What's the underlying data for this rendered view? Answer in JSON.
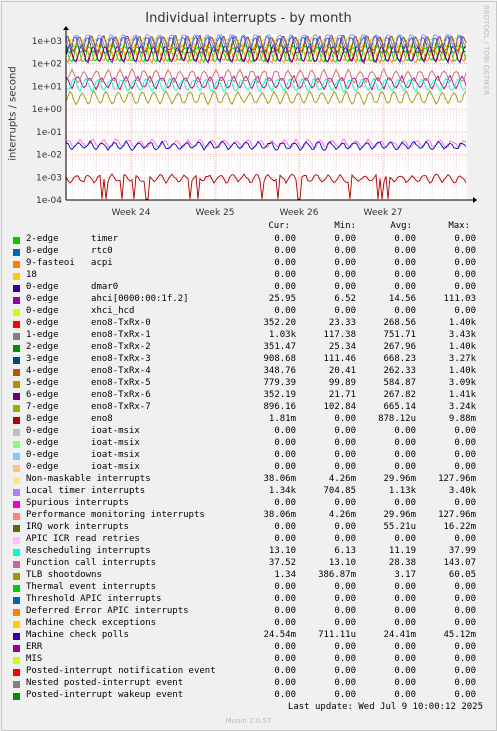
{
  "chart_data": {
    "type": "line",
    "title": "Individual interrupts - by month",
    "ylabel": "interrupts / second",
    "yscale": "log",
    "ylim": [
      0.0001,
      2000
    ],
    "yticks": [
      "1e+03",
      "1e+02",
      "1e+01",
      "1e+00",
      "1e-01",
      "1e-02",
      "1e-03",
      "1e-04"
    ],
    "xticks": [
      "Week 24",
      "Week 25",
      "Week 26",
      "Week 27"
    ],
    "series": [
      {
        "name": "eno8-TxRx-0",
        "color": "#ff0000",
        "level": 268.56
      },
      {
        "name": "eno8-TxRx-1",
        "color": "#a000a0",
        "level": 751.71
      },
      {
        "name": "eno8-TxRx-2",
        "color": "#00cc00",
        "level": 267.96
      },
      {
        "name": "eno8-TxRx-3",
        "color": "#0066b3",
        "level": 668.23
      },
      {
        "name": "eno8-TxRx-4",
        "color": "#ff8000",
        "level": 262.33
      },
      {
        "name": "eno8-TxRx-5",
        "color": "#ffcc00",
        "level": 584.87
      },
      {
        "name": "eno8-TxRx-6",
        "color": "#330099",
        "level": 267.82
      },
      {
        "name": "eno8-TxRx-7",
        "color": "#808000",
        "level": 665.14
      },
      {
        "name": "ahci[0000:00:1f.2]",
        "color": "#990099",
        "level": 14.56
      },
      {
        "name": "Local timer interrupts",
        "color": "#8080ff",
        "level": 1130
      },
      {
        "name": "Rescheduling interrupts",
        "color": "#00ffcc",
        "level": 11.19
      },
      {
        "name": "Function call interrupts",
        "color": "#cc6666",
        "level": 28.38
      },
      {
        "name": "TLB shootdowns",
        "color": "#999900",
        "level": 3.17
      },
      {
        "name": "Non-maskable interrupts",
        "color": "#ff66cc",
        "level": 0.02996
      },
      {
        "name": "Machine check polls",
        "color": "#0000cc",
        "level": 0.02441
      },
      {
        "name": "eno8",
        "color": "#aa0000",
        "level": 0.000878
      }
    ]
  },
  "side_label": "RRDTOOL / TOBI OETIKER",
  "legend": {
    "headers": {
      "cur": "Cur:",
      "min": "Min:",
      "avg": "Avg:",
      "max": "Max:"
    },
    "rows": [
      {
        "color": "#00cc00",
        "name": "2-edge      timer",
        "cur": "0.00",
        "min": "0.00",
        "avg": "0.00",
        "max": "0.00"
      },
      {
        "color": "#0066b3",
        "name": "8-edge      rtc0",
        "cur": "0.00",
        "min": "0.00",
        "avg": "0.00",
        "max": "0.00"
      },
      {
        "color": "#ff8000",
        "name": "9-fasteoi   acpi",
        "cur": "0.00",
        "min": "0.00",
        "avg": "0.00",
        "max": "0.00"
      },
      {
        "color": "#ffcc00",
        "name": "18",
        "cur": "0.00",
        "min": "0.00",
        "avg": "0.00",
        "max": "0.00"
      },
      {
        "color": "#330099",
        "name": "0-edge      dmar0",
        "cur": "0.00",
        "min": "0.00",
        "avg": "0.00",
        "max": "0.00"
      },
      {
        "color": "#990099",
        "name": "0-edge      ahci[0000:00:1f.2]",
        "cur": "25.95",
        "min": "6.52",
        "avg": "14.56",
        "max": "111.03"
      },
      {
        "color": "#ccff00",
        "name": "0-edge      xhci_hcd",
        "cur": "0.00",
        "min": "0.00",
        "avg": "0.00",
        "max": "0.00"
      },
      {
        "color": "#ff0000",
        "name": "0-edge      eno8-TxRx-0",
        "cur": "352.20",
        "min": "23.33",
        "avg": "268.56",
        "max": "1.40k"
      },
      {
        "color": "#808080",
        "name": "1-edge      eno8-TxRx-1",
        "cur": "1.03k",
        "min": "117.38",
        "avg": "751.71",
        "max": "3.43k"
      },
      {
        "color": "#008f00",
        "name": "2-edge      eno8-TxRx-2",
        "cur": "351.47",
        "min": "25.34",
        "avg": "267.96",
        "max": "1.40k"
      },
      {
        "color": "#00487d",
        "name": "3-edge      eno8-TxRx-3",
        "cur": "908.68",
        "min": "111.46",
        "avg": "668.23",
        "max": "3.27k"
      },
      {
        "color": "#b35a00",
        "name": "4-edge      eno8-TxRx-4",
        "cur": "348.76",
        "min": "20.41",
        "avg": "262.33",
        "max": "1.40k"
      },
      {
        "color": "#b38f00",
        "name": "5-edge      eno8-TxRx-5",
        "cur": "779.39",
        "min": "99.89",
        "avg": "584.87",
        "max": "3.09k"
      },
      {
        "color": "#6b006b",
        "name": "6-edge      eno8-TxRx-6",
        "cur": "352.19",
        "min": "21.71",
        "avg": "267.82",
        "max": "1.41k"
      },
      {
        "color": "#8fb300",
        "name": "7-edge      eno8-TxRx-7",
        "cur": "896.16",
        "min": "102.84",
        "avg": "665.14",
        "max": "3.24k"
      },
      {
        "color": "#b30000",
        "name": "8-edge      eno8",
        "cur": "1.81m",
        "min": "0.00",
        "avg": "878.12u",
        "max": "9.88m"
      },
      {
        "color": "#bebebe",
        "name": "0-edge      ioat-msix",
        "cur": "0.00",
        "min": "0.00",
        "avg": "0.00",
        "max": "0.00"
      },
      {
        "color": "#80ff80",
        "name": "0-edge      ioat-msix",
        "cur": "0.00",
        "min": "0.00",
        "avg": "0.00",
        "max": "0.00"
      },
      {
        "color": "#80c9ff",
        "name": "0-edge      ioat-msix",
        "cur": "0.00",
        "min": "0.00",
        "avg": "0.00",
        "max": "0.00"
      },
      {
        "color": "#ffc080",
        "name": "0-edge      ioat-msix",
        "cur": "0.00",
        "min": "0.00",
        "avg": "0.00",
        "max": "0.00"
      },
      {
        "color": "#ffe680",
        "name": "Non-maskable interrupts",
        "cur": "38.06m",
        "min": "4.26m",
        "avg": "29.96m",
        "max": "127.96m"
      },
      {
        "color": "#aa80ff",
        "name": "Local timer interrupts",
        "cur": "1.34k",
        "min": "704.85",
        "avg": "1.13k",
        "max": "3.40k"
      },
      {
        "color": "#ee00cc",
        "name": "Spurious interrupts",
        "cur": "0.00",
        "min": "0.00",
        "avg": "0.00",
        "max": "0.00"
      },
      {
        "color": "#ff8080",
        "name": "Performance monitoring interrupts",
        "cur": "38.06m",
        "min": "4.26m",
        "avg": "29.96m",
        "max": "127.96m"
      },
      {
        "color": "#666600",
        "name": "IRQ work interrupts",
        "cur": "0.00",
        "min": "0.00",
        "avg": "55.21u",
        "max": "16.22m"
      },
      {
        "color": "#ffbfff",
        "name": "APIC ICR read retries",
        "cur": "0.00",
        "min": "0.00",
        "avg": "0.00",
        "max": "0.00"
      },
      {
        "color": "#00ffcc",
        "name": "Rescheduling interrupts",
        "cur": "13.10",
        "min": "6.13",
        "avg": "11.19",
        "max": "37.99"
      },
      {
        "color": "#cc6699",
        "name": "Function call interrupts",
        "cur": "37.52",
        "min": "13.10",
        "avg": "28.38",
        "max": "143.07"
      },
      {
        "color": "#999900",
        "name": "TLB shootdowns",
        "cur": "1.34",
        "min": "386.87m",
        "avg": "3.17",
        "max": "60.05"
      },
      {
        "color": "#00cc00",
        "name": "Thermal event interrupts",
        "cur": "0.00",
        "min": "0.00",
        "avg": "0.00",
        "max": "0.00"
      },
      {
        "color": "#0066b3",
        "name": "Threshold APIC interrupts",
        "cur": "0.00",
        "min": "0.00",
        "avg": "0.00",
        "max": "0.00"
      },
      {
        "color": "#ff8000",
        "name": "Deferred Error APIC interrupts",
        "cur": "0.00",
        "min": "0.00",
        "avg": "0.00",
        "max": "0.00"
      },
      {
        "color": "#ffcc00",
        "name": "Machine check exceptions",
        "cur": "0.00",
        "min": "0.00",
        "avg": "0.00",
        "max": "0.00"
      },
      {
        "color": "#330099",
        "name": "Machine check polls",
        "cur": "24.54m",
        "min": "711.11u",
        "avg": "24.41m",
        "max": "45.12m"
      },
      {
        "color": "#990099",
        "name": "ERR",
        "cur": "0.00",
        "min": "0.00",
        "avg": "0.00",
        "max": "0.00"
      },
      {
        "color": "#ccff00",
        "name": "MIS",
        "cur": "0.00",
        "min": "0.00",
        "avg": "0.00",
        "max": "0.00"
      },
      {
        "color": "#ff0000",
        "name": "Posted-interrupt notification event",
        "cur": "0.00",
        "min": "0.00",
        "avg": "0.00",
        "max": "0.00"
      },
      {
        "color": "#808080",
        "name": "Nested posted-interrupt event",
        "cur": "0.00",
        "min": "0.00",
        "avg": "0.00",
        "max": "0.00"
      },
      {
        "color": "#008f00",
        "name": "Posted-interrupt wakeup event",
        "cur": "0.00",
        "min": "0.00",
        "avg": "0.00",
        "max": "0.00"
      }
    ]
  },
  "footer": {
    "last_update": "Last update: Wed Jul  9 10:00:12 2025",
    "munin": "Munin 2.0.57"
  }
}
